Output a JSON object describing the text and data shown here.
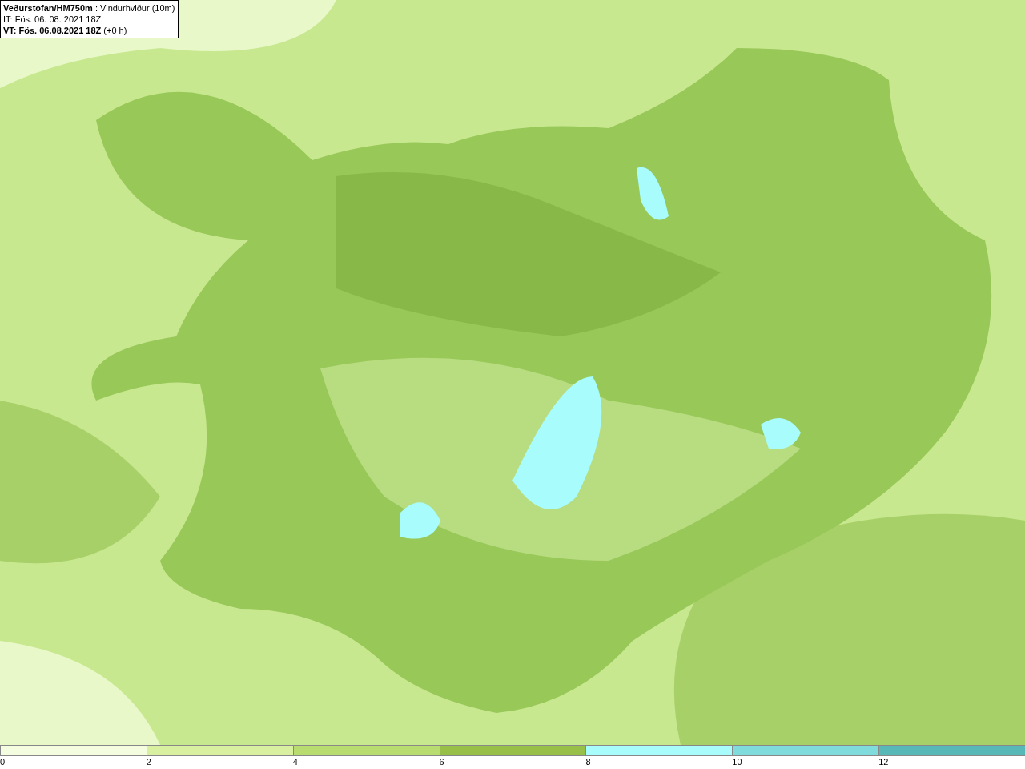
{
  "info_box": {
    "lines": [
      "**Veðurstofan/HM750m** : Vindurhviður (10m)",
      "IT: Fös. 06. 08. 2021 18Z",
      "**VT: Fös. 06.08.2021 18Z** (+0 h)"
    ]
  },
  "legend": {
    "items": [
      {
        "label": "0",
        "color": "#f5fde0"
      },
      {
        "label": "2",
        "color": "#d8f0a0"
      },
      {
        "label": "4",
        "color": "#b8dc70"
      },
      {
        "label": "6",
        "color": "#98c048"
      },
      {
        "label": "8",
        "color": "#a8fcfc"
      },
      {
        "label": "10",
        "color": "#80dcdc"
      },
      {
        "label": "12",
        "color": "#58b8b8"
      }
    ]
  }
}
